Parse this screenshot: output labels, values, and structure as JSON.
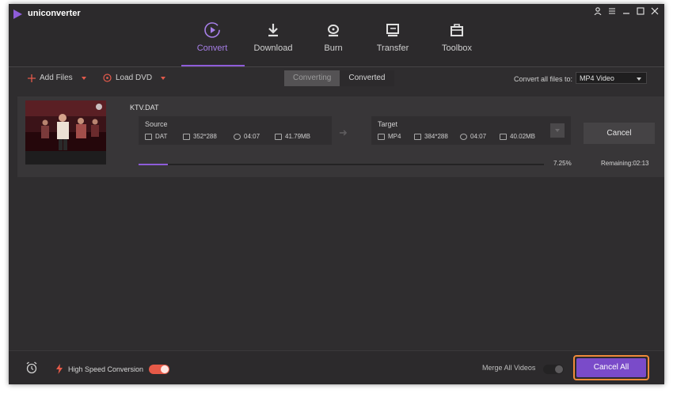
{
  "app": {
    "name": "uniconverter"
  },
  "nav": [
    {
      "label": "Convert",
      "icon": "convert-icon",
      "active": true
    },
    {
      "label": "Download",
      "icon": "download-icon",
      "active": false
    },
    {
      "label": "Burn",
      "icon": "burn-icon",
      "active": false
    },
    {
      "label": "Transfer",
      "icon": "transfer-icon",
      "active": false
    },
    {
      "label": "Toolbox",
      "icon": "toolbox-icon",
      "active": false
    }
  ],
  "toolbar": {
    "add_files": "Add Files",
    "load_dvd": "Load DVD",
    "tabs": [
      "Converting",
      "Converted"
    ],
    "convert_all_label": "Convert all files to:",
    "format": "MP4 Video"
  },
  "file": {
    "name": "KTV.DAT",
    "source": {
      "label": "Source",
      "format": "DAT",
      "resolution": "352*288",
      "duration": "04:07",
      "size": "41.79MB"
    },
    "target": {
      "label": "Target",
      "format": "MP4",
      "resolution": "384*288",
      "duration": "04:07",
      "size": "40.02MB"
    },
    "cancel_label": "Cancel",
    "progress_text": "7.25%",
    "progress_value": 0.0725,
    "remaining": "Remaining:02:13"
  },
  "bottom": {
    "high_speed": "High Speed Conversion",
    "high_speed_on": true,
    "merge": "Merge All Videos",
    "merge_on": false,
    "cancel_all": "Cancel All"
  },
  "colors": {
    "accent": "#8e5cd9",
    "toggle_on": "#e65a48",
    "highlight": "#f08a3a"
  }
}
